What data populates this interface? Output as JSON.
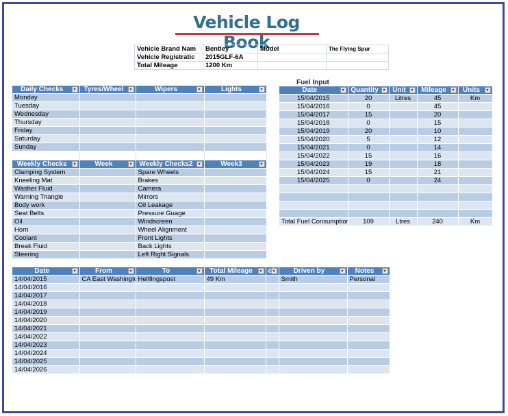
{
  "title": "Vehicle Log Book",
  "vehicle_info": {
    "rows": [
      {
        "label": "Vehicle Brand Nam",
        "value": "Bentley",
        "label2": "Model",
        "value2": "The Flying Spur"
      },
      {
        "label": "Vehicle Registratic",
        "value": "2015GLF-6A",
        "label2": "",
        "value2": ""
      },
      {
        "label": "Total Mileage",
        "value": "1200 Km",
        "label2": "",
        "value2": ""
      }
    ]
  },
  "daily_checks": {
    "headers": [
      "Daily Checks",
      "Tyres/Wheel",
      "Wipers",
      "Lights"
    ],
    "rows": [
      "Monday",
      "Tuesday",
      "Wednesday",
      "Thursday",
      "Friday",
      "Saturday",
      "Sunday"
    ]
  },
  "weekly_checks": {
    "headers": [
      "Weekly Checks",
      "Week",
      "Weekly Checks2",
      "Week3"
    ],
    "rows": [
      [
        "Clamping System",
        "",
        "Spare Wheels",
        ""
      ],
      [
        "Kneeling Mat",
        "",
        "Brakes",
        ""
      ],
      [
        "Washer Fluid",
        "",
        "Camera",
        ""
      ],
      [
        "Warning Triangle",
        "",
        "Mirrors",
        ""
      ],
      [
        "Body work",
        "",
        "Oil Leakage",
        ""
      ],
      [
        "Seat Belts",
        "",
        "Pressure Guage",
        ""
      ],
      [
        "Oil",
        "",
        "Windscreen",
        ""
      ],
      [
        "Horn",
        "",
        "Wheel Alignment",
        ""
      ],
      [
        "Coolant",
        "",
        "Front Lights",
        ""
      ],
      [
        "Break Fluid",
        "",
        "Back Lights",
        ""
      ],
      [
        "Steering",
        "",
        "Left Right Signals",
        ""
      ]
    ]
  },
  "fuel_input": {
    "caption": "Fuel Input",
    "headers": [
      "Date",
      "Quantity",
      "Unit",
      "Mileage",
      "Units"
    ],
    "rows": [
      [
        "15/04/2015",
        "20",
        "Litres",
        "45",
        "Km"
      ],
      [
        "15/04/2016",
        "0",
        "",
        "45",
        ""
      ],
      [
        "15/04/2017",
        "15",
        "",
        "20",
        ""
      ],
      [
        "15/04/2018",
        "0",
        "",
        "15",
        ""
      ],
      [
        "15/04/2019",
        "20",
        "",
        "10",
        ""
      ],
      [
        "15/04/2020",
        "5",
        "",
        "12",
        ""
      ],
      [
        "15/04/2021",
        "0",
        "",
        "14",
        ""
      ],
      [
        "15/04/2022",
        "15",
        "",
        "16",
        ""
      ],
      [
        "15/04/2023",
        "19",
        "",
        "18",
        ""
      ],
      [
        "15/04/2024",
        "15",
        "",
        "21",
        ""
      ],
      [
        "15/04/2025",
        "0",
        "",
        "24",
        ""
      ],
      [
        "",
        "",
        "",
        "",
        ""
      ],
      [
        "",
        "",
        "",
        "",
        ""
      ],
      [
        "",
        "",
        "",
        "",
        ""
      ],
      [
        "",
        "",
        "",
        "",
        ""
      ]
    ],
    "total": [
      "Total Fuel Consumptior",
      "109",
      "Ltres",
      "240",
      "Km"
    ]
  },
  "trips": {
    "headers": [
      "Date",
      "From",
      "To",
      "Total Mileage",
      "ol",
      "Driven by",
      "Notes"
    ],
    "rows": [
      [
        "14/04/2015",
        "CA East Washingtc",
        "Hellfingspost",
        "49 Km",
        "",
        "Smith",
        "Personal"
      ],
      [
        "14/04/2016",
        "",
        "",
        "",
        "",
        "",
        ""
      ],
      [
        "14/04/2017",
        "",
        "",
        "",
        "",
        "",
        ""
      ],
      [
        "14/04/2018",
        "",
        "",
        "",
        "",
        "",
        ""
      ],
      [
        "14/04/2019",
        "",
        "",
        "",
        "",
        "",
        ""
      ],
      [
        "14/04/2020",
        "",
        "",
        "",
        "",
        "",
        ""
      ],
      [
        "14/04/2021",
        "",
        "",
        "",
        "",
        "",
        ""
      ],
      [
        "14/04/2022",
        "",
        "",
        "",
        "",
        "",
        ""
      ],
      [
        "14/04/2023",
        "",
        "",
        "",
        "",
        "",
        ""
      ],
      [
        "14/04/2024",
        "",
        "",
        "",
        "",
        "",
        ""
      ],
      [
        "14/04/2025",
        "",
        "",
        "",
        "",
        "",
        ""
      ],
      [
        "14/04/2026",
        "",
        "",
        "",
        "",
        "",
        ""
      ]
    ]
  },
  "icons": {
    "dropdown": "▾"
  }
}
